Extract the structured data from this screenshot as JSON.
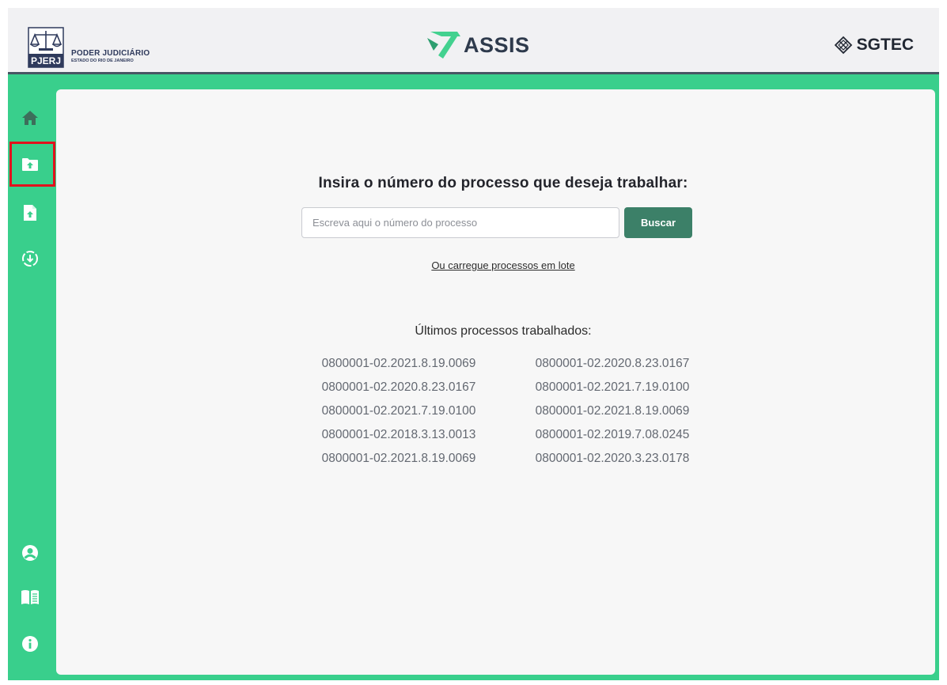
{
  "header": {
    "pjerj_badge": "PJERJ",
    "pjerj_title": "PODER JUDICIÁRIO",
    "pjerj_subtitle": "ESTADO DO RIO DE JANEIRO",
    "app_name": "ASSIS",
    "partner_name": "SGTEC"
  },
  "sidebar": {
    "top_icons": [
      "home-icon",
      "folder-upload-icon",
      "file-upload-icon",
      "download-circle-icon"
    ],
    "bottom_icons": [
      "user-icon",
      "manual-book-icon",
      "info-icon"
    ],
    "active_item": "folder-upload-icon"
  },
  "main": {
    "prompt": "Insira o número do processo que deseja trabalhar:",
    "search_placeholder": "Escreva aqui o número do processo",
    "search_value": "",
    "search_button": "Buscar",
    "batch_link": "Ou carregue processos em lote",
    "recent_title": "Últimos processos trabalhados:",
    "recent_processes": [
      "0800001-02.2021.8.19.0069",
      "0800001-02.2020.8.23.0167",
      "0800001-02.2020.8.23.0167",
      "0800001-02.2021.7.19.0100",
      "0800001-02.2021.7.19.0100",
      "0800001-02.2021.8.19.0069",
      "0800001-02.2018.3.13.0013",
      "0800001-02.2019.7.08.0245",
      "0800001-02.2021.8.19.0069",
      "0800001-02.2020.3.23.0178"
    ]
  },
  "colors": {
    "sidebar_green": "#39cf8c",
    "button_green": "#3c8068",
    "highlight_red": "#e2111d",
    "header_bg": "#f1f1f3",
    "content_bg": "#f7f7f7"
  }
}
